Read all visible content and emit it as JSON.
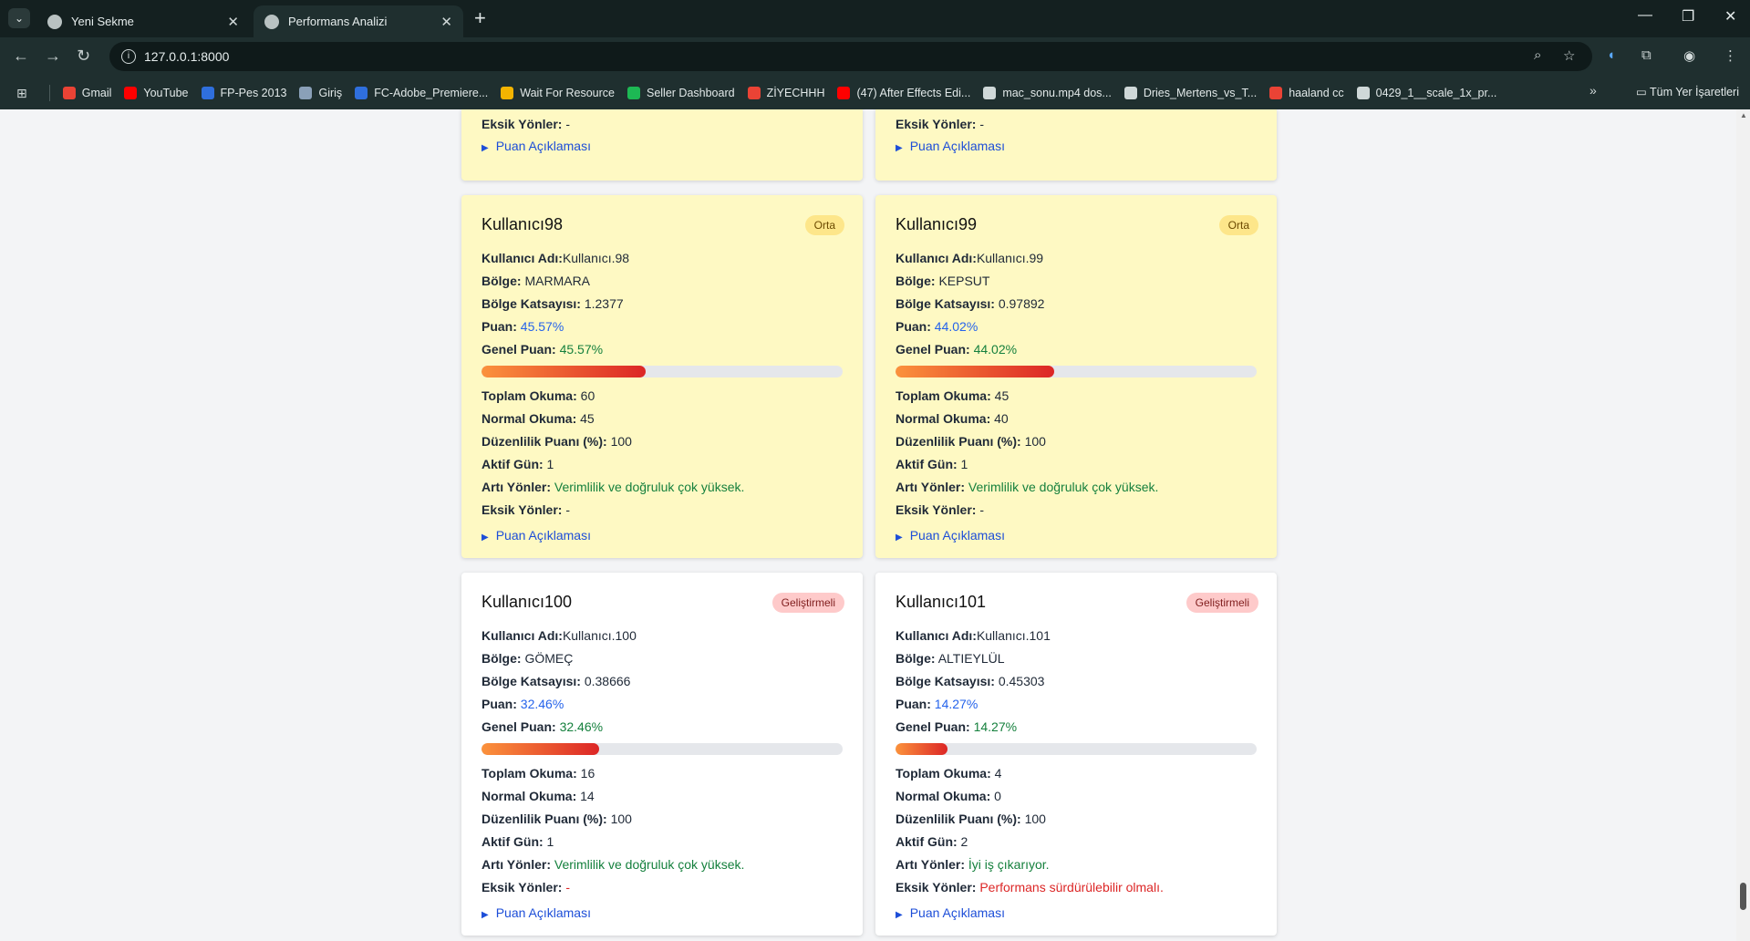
{
  "browser": {
    "tabs": [
      {
        "title": "Yeni Sekme"
      },
      {
        "title": "Performans Analizi"
      }
    ],
    "address": "127.0.0.1:8000",
    "bookmarks": [
      {
        "label": "Gmail",
        "color": "#ea4335"
      },
      {
        "label": "YouTube",
        "color": "#ff0000"
      },
      {
        "label": "FP-Pes 2013",
        "color": "#2f6fdd"
      },
      {
        "label": "Giriş",
        "color": "#8aa0b8"
      },
      {
        "label": "FC-Adobe_Premiere...",
        "color": "#2f6fdd"
      },
      {
        "label": "Wait For Resource",
        "color": "#f4b400"
      },
      {
        "label": "Seller Dashboard",
        "color": "#1db954"
      },
      {
        "label": "ZİYECHHH",
        "color": "#ea4335"
      },
      {
        "label": "(47) After Effects Edi...",
        "color": "#ff0000"
      },
      {
        "label": "mac_sonu.mp4 dos...",
        "color": "#cfd8d8"
      },
      {
        "label": "Dries_Mertens_vs_T...",
        "color": "#cfd8d8"
      },
      {
        "label": "haaland cc",
        "color": "#ea4335"
      },
      {
        "label": "0429_1__scale_1x_pr...",
        "color": "#cfd8d8"
      }
    ],
    "all_bookmarks": "Tüm Yer İşaretleri"
  },
  "labels": {
    "username": "Kullanıcı Adı:",
    "region": "Bölge:",
    "coef": "Bölge Katsayısı:",
    "score": "Puan:",
    "overall": "Genel Puan:",
    "total": "Toplam Okuma:",
    "normal": "Normal Okuma:",
    "regularity": "Düzenlilik Puanı (%):",
    "active": "Aktif Gün:",
    "pros": "Artı Yönler:",
    "cons": "Eksik Yönler:",
    "explain": "Puan Açıklaması"
  },
  "partial_cards": [
    {
      "cons": "-"
    },
    {
      "cons": "-"
    }
  ],
  "cards": [
    {
      "name": "Kullanıcı98",
      "badge": "Orta",
      "username": "Kullanıcı.98",
      "region": "MARMARA",
      "coef": "1.2377",
      "score": "45.57%",
      "overall": "45.57%",
      "overall_value": 0.4557,
      "total": "60",
      "normal": "45",
      "regularity": "100",
      "active": "1",
      "pros": "Verimlilik ve doğruluk çok yüksek.",
      "cons": "-"
    },
    {
      "name": "Kullanıcı99",
      "badge": "Orta",
      "username": "Kullanıcı.99",
      "region": "KEPSUT",
      "coef": "0.97892",
      "score": "44.02%",
      "overall": "44.02%",
      "overall_value": 0.4402,
      "total": "45",
      "normal": "40",
      "regularity": "100",
      "active": "1",
      "pros": "Verimlilik ve doğruluk çok yüksek.",
      "cons": "-"
    },
    {
      "name": "Kullanıcı100",
      "badge": "Geliştirmeli",
      "username": "Kullanıcı.100",
      "region": "GÖMEÇ",
      "coef": "0.38666",
      "score": "32.46%",
      "overall": "32.46%",
      "overall_value": 0.3246,
      "total": "16",
      "normal": "14",
      "regularity": "100",
      "active": "1",
      "pros": "Verimlilik ve doğruluk çok yüksek.",
      "cons": "-"
    },
    {
      "name": "Kullanıcı101",
      "badge": "Geliştirmeli",
      "username": "Kullanıcı.101",
      "region": "ALTIEYLÜL",
      "coef": "0.45303",
      "score": "14.27%",
      "overall": "14.27%",
      "overall_value": 0.1427,
      "total": "4",
      "normal": "0",
      "regularity": "100",
      "active": "2",
      "pros": "İyi iş çıkarıyor.",
      "cons": "Performans sürdürülebilir olmalı."
    }
  ]
}
